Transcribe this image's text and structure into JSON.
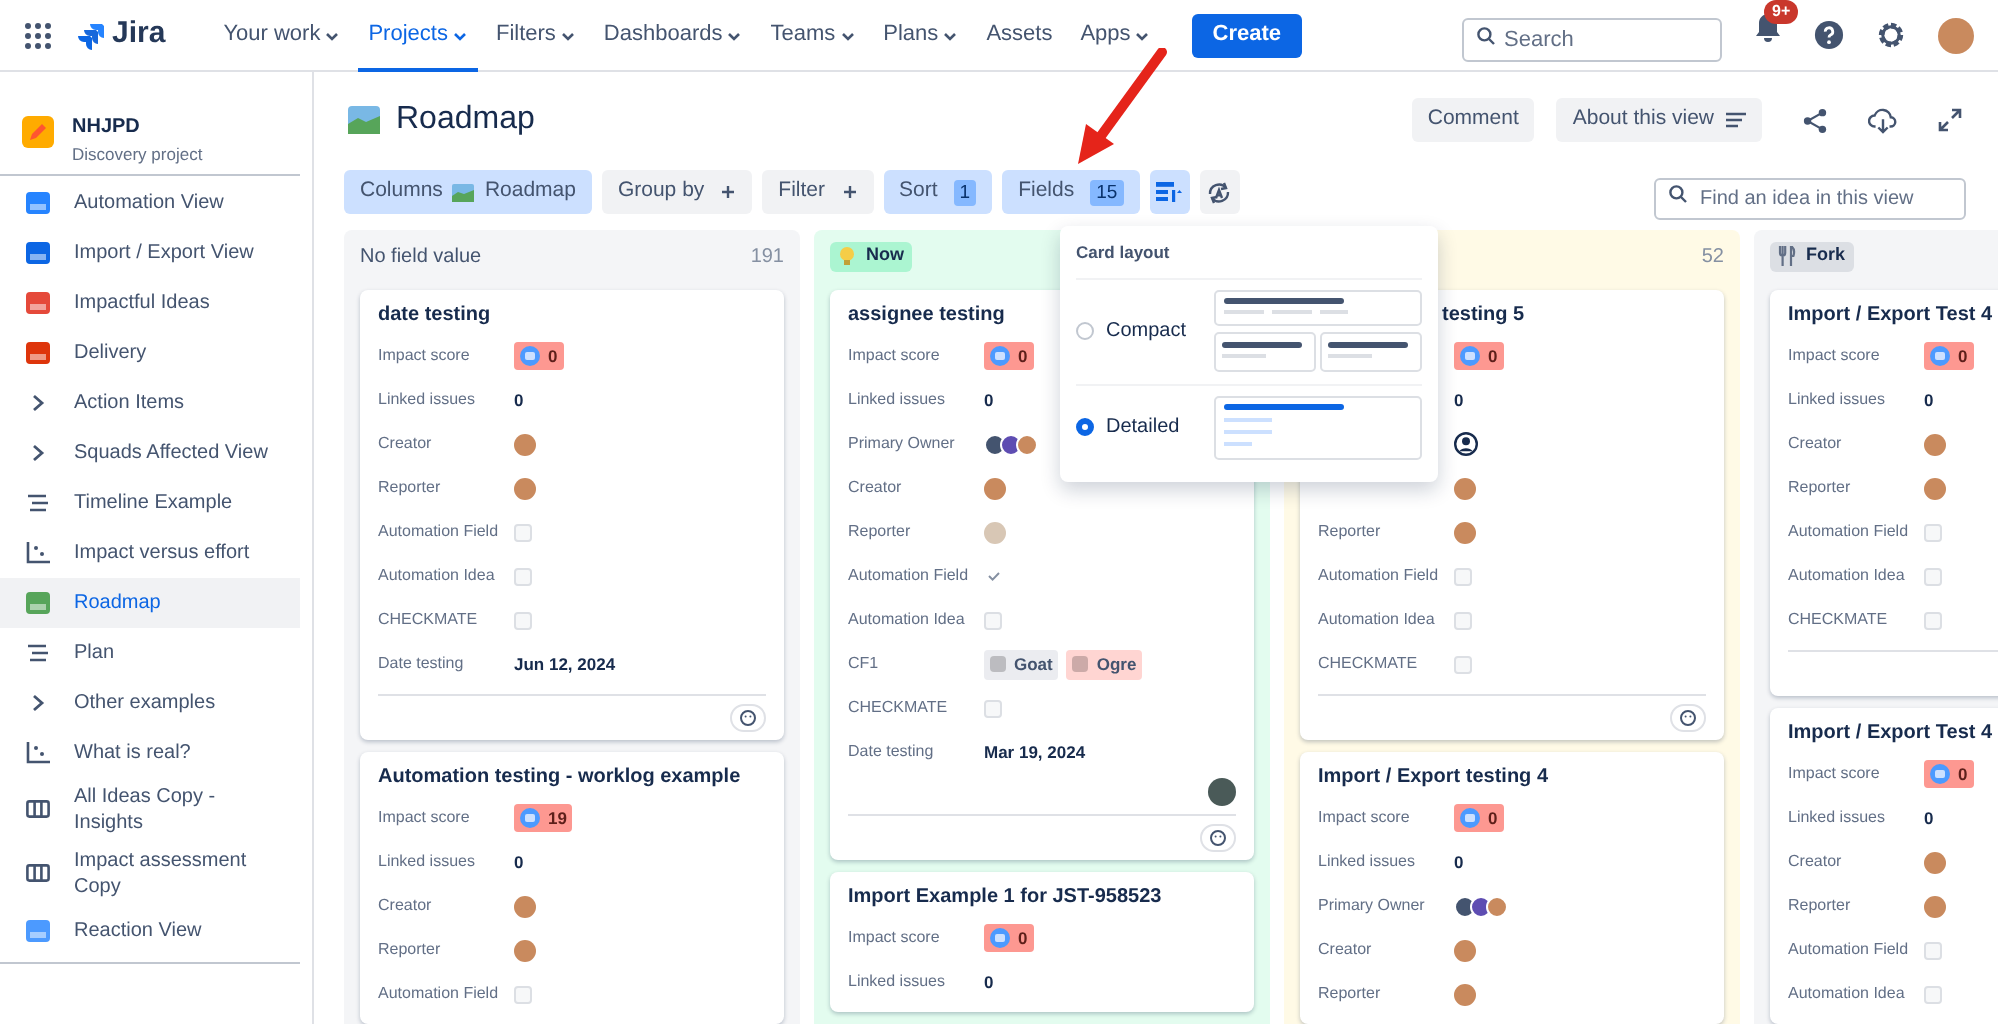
{
  "nav": {
    "product": "Jira",
    "items": [
      {
        "label": "Your work",
        "dropdown": true,
        "selected": false
      },
      {
        "label": "Projects",
        "dropdown": true,
        "selected": true
      },
      {
        "label": "Filters",
        "dropdown": true,
        "selected": false
      },
      {
        "label": "Dashboards",
        "dropdown": true,
        "selected": false
      },
      {
        "label": "Teams",
        "dropdown": true,
        "selected": false
      },
      {
        "label": "Plans",
        "dropdown": true,
        "selected": false
      },
      {
        "label": "Assets",
        "dropdown": false,
        "selected": false
      },
      {
        "label": "Apps",
        "dropdown": true,
        "selected": false
      }
    ],
    "create": "Create",
    "search_placeholder": "Search",
    "notification_badge": "9+"
  },
  "project": {
    "name": "NHJPD",
    "type": "Discovery project"
  },
  "sidebar": {
    "items": [
      {
        "label": "Automation View",
        "kind": "emoji",
        "color": "#2684ff",
        "selected": false
      },
      {
        "label": "Import / Export View",
        "kind": "emoji",
        "color": "#0c66e4",
        "selected": false
      },
      {
        "label": "Impactful Ideas",
        "kind": "emoji",
        "color": "#e5493a",
        "selected": false
      },
      {
        "label": "Delivery",
        "kind": "emoji",
        "color": "#de350b",
        "selected": false
      },
      {
        "label": "Action Items",
        "kind": "chevron",
        "selected": false
      },
      {
        "label": "Squads Affected View",
        "kind": "chevron",
        "selected": false
      },
      {
        "label": "Timeline Example",
        "kind": "timeline",
        "selected": false
      },
      {
        "label": "Impact versus effort",
        "kind": "matrix",
        "selected": false
      },
      {
        "label": "Roadmap",
        "kind": "emoji",
        "color": "#57a55a",
        "selected": true
      },
      {
        "label": "Plan",
        "kind": "timeline",
        "selected": false
      },
      {
        "label": "Other examples",
        "kind": "chevron",
        "selected": false
      },
      {
        "label": "What is real?",
        "kind": "matrix",
        "selected": false
      },
      {
        "label": "All Ideas Copy - Insights",
        "kind": "board",
        "selected": false
      },
      {
        "label": "Impact assessment Copy",
        "kind": "board",
        "selected": false
      },
      {
        "label": "Reaction View",
        "kind": "emoji",
        "color": "#4c9aff",
        "selected": false
      }
    ]
  },
  "header": {
    "title": "Roadmap",
    "comment": "Comment",
    "about": "About this view"
  },
  "toolbar": {
    "buttons": [
      {
        "kind": "columns",
        "label": "Columns",
        "value": "Roadmap",
        "active": true
      },
      {
        "kind": "plus",
        "label": "Group by",
        "active": false
      },
      {
        "kind": "plus",
        "label": "Filter",
        "active": false
      },
      {
        "kind": "count",
        "label": "Sort",
        "value": "1",
        "active": true
      },
      {
        "kind": "count",
        "label": "Fields",
        "value": "15",
        "active": true
      },
      {
        "kind": "layout",
        "active": true
      },
      {
        "kind": "arrange",
        "active": false
      }
    ],
    "search_placeholder": "Find an idea in this view"
  },
  "popup": {
    "title": "Card layout",
    "options": [
      {
        "label": "Compact",
        "kind": "compact",
        "selected": false
      },
      {
        "label": "Detailed",
        "kind": "detailed",
        "selected": true
      }
    ]
  },
  "board": {
    "columns": [
      {
        "header": {
          "kind": "plain",
          "label": "No field value",
          "count": "191"
        },
        "color": "#f4f5f7",
        "cards": [
          {
            "title": "date testing",
            "covered": false,
            "assignee": false,
            "footer": true,
            "fields": [
              {
                "label": "Impact score",
                "kind": "score",
                "value": "0"
              },
              {
                "label": "Linked issues",
                "kind": "number",
                "value": "0"
              },
              {
                "label": "Creator",
                "kind": "person"
              },
              {
                "label": "Reporter",
                "kind": "person"
              },
              {
                "label": "Automation Field",
                "kind": "checkbox",
                "checked": false
              },
              {
                "label": "Automation Idea",
                "kind": "checkbox",
                "checked": false
              },
              {
                "label": "CHECKMATE",
                "kind": "checkbox",
                "checked": false
              },
              {
                "label": "Date testing",
                "kind": "date",
                "value": "Jun 12, 2024"
              }
            ]
          },
          {
            "title": "Automation testing - worklog example",
            "covered": false,
            "assignee": false,
            "footer": false,
            "fields": [
              {
                "label": "Impact score",
                "kind": "score",
                "value": "19"
              },
              {
                "label": "Linked issues",
                "kind": "number",
                "value": "0"
              },
              {
                "label": "Creator",
                "kind": "person"
              },
              {
                "label": "Reporter",
                "kind": "person"
              },
              {
                "label": "Automation Field",
                "kind": "checkbox",
                "checked": false
              }
            ]
          }
        ]
      },
      {
        "header": {
          "kind": "bulb",
          "label": "Now"
        },
        "color": "#e3fcef",
        "cards": [
          {
            "title": "assignee testing",
            "covered": false,
            "assignee": true,
            "footer": true,
            "fields": [
              {
                "label": "Impact score",
                "kind": "score",
                "value": "0"
              },
              {
                "label": "Linked issues",
                "kind": "number",
                "value": "0"
              },
              {
                "label": "Primary Owner",
                "kind": "people"
              },
              {
                "label": "Creator",
                "kind": "person"
              },
              {
                "label": "Reporter",
                "kind": "photo"
              },
              {
                "label": "Automation Field",
                "kind": "checkbox",
                "checked": true
              },
              {
                "label": "Automation Idea",
                "kind": "checkbox",
                "checked": false
              },
              {
                "label": "CF1",
                "kind": "tags",
                "tags": [
                  {
                    "label": "Goat",
                    "color": "#ebecf0"
                  },
                  {
                    "label": "Ogre",
                    "color": "#ffd5d2"
                  }
                ]
              },
              {
                "label": "CHECKMATE",
                "kind": "checkbox",
                "checked": false
              },
              {
                "label": "Date testing",
                "kind": "date",
                "value": "Mar 19, 2024"
              }
            ]
          },
          {
            "title": "Import Example 1 for JST-958523",
            "covered": false,
            "assignee": false,
            "footer": false,
            "fields": [
              {
                "label": "Impact score",
                "kind": "score",
                "value": "0"
              },
              {
                "label": "Linked issues",
                "kind": "number",
                "value": "0"
              }
            ]
          }
        ]
      },
      {
        "header": {
          "kind": "none",
          "count": "52"
        },
        "color": "#fffae6",
        "cards": [
          {
            "title": "testing 5",
            "covered": true,
            "assignee": false,
            "footer": true,
            "fields": [
              {
                "kind": "score",
                "value": "0"
              },
              {
                "kind": "number",
                "value": "0"
              },
              {
                "kind": "generic"
              },
              {
                "kind": "person"
              },
              {
                "label": "Reporter",
                "kind": "person"
              },
              {
                "label": "Automation Field",
                "kind": "checkbox",
                "checked": false
              },
              {
                "label": "Automation Idea",
                "kind": "checkbox",
                "checked": false
              },
              {
                "label": "CHECKMATE",
                "kind": "checkbox",
                "checked": false
              }
            ]
          },
          {
            "title": "Import / Export testing 4",
            "covered": false,
            "assignee": false,
            "footer": false,
            "fields": [
              {
                "label": "Impact score",
                "kind": "score",
                "value": "0"
              },
              {
                "label": "Linked issues",
                "kind": "number",
                "value": "0"
              },
              {
                "label": "Primary Owner",
                "kind": "people"
              },
              {
                "label": "Creator",
                "kind": "person"
              },
              {
                "label": "Reporter",
                "kind": "person"
              }
            ]
          }
        ]
      },
      {
        "header": {
          "kind": "fork",
          "label": "Fork"
        },
        "color": "#f4f5f7",
        "cards": [
          {
            "title": "Import / Export Test 4",
            "covered": false,
            "assignee": false,
            "footer": true,
            "fields": [
              {
                "label": "Impact score",
                "kind": "score",
                "value": "0"
              },
              {
                "label": "Linked issues",
                "kind": "number",
                "value": "0"
              },
              {
                "label": "Creator",
                "kind": "person"
              },
              {
                "label": "Reporter",
                "kind": "person"
              },
              {
                "label": "Automation Field",
                "kind": "checkbox",
                "checked": false
              },
              {
                "label": "Automation Idea",
                "kind": "checkbox",
                "checked": false
              },
              {
                "label": "CHECKMATE",
                "kind": "checkbox",
                "checked": false
              }
            ]
          },
          {
            "title": "Import / Export Test 4",
            "covered": false,
            "assignee": false,
            "footer": false,
            "fields": [
              {
                "label": "Impact score",
                "kind": "score",
                "value": "0"
              },
              {
                "label": "Linked issues",
                "kind": "number",
                "value": "0"
              },
              {
                "label": "Creator",
                "kind": "person"
              },
              {
                "label": "Reporter",
                "kind": "person"
              },
              {
                "label": "Automation Field",
                "kind": "checkbox",
                "checked": false
              },
              {
                "label": "Automation Idea",
                "kind": "checkbox",
                "checked": false
              }
            ]
          }
        ]
      }
    ]
  }
}
